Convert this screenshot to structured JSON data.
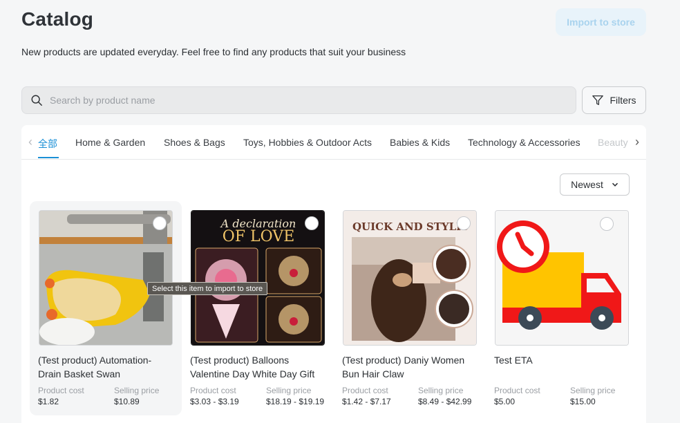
{
  "header": {
    "title": "Catalog",
    "import_label": "Import to store",
    "subtitle": "New products are updated everyday. Feel free to find any products that suit your business"
  },
  "search": {
    "placeholder": "Search by product name",
    "value": ""
  },
  "filters": {
    "label": "Filters"
  },
  "tabs": [
    {
      "label": "全部",
      "active": true
    },
    {
      "label": "Home & Garden"
    },
    {
      "label": "Shoes & Bags"
    },
    {
      "label": "Toys, Hobbies & Outdoor Acts"
    },
    {
      "label": "Babies & Kids"
    },
    {
      "label": "Technology & Accessories"
    },
    {
      "label": "Beauty"
    }
  ],
  "sort": {
    "selected": "Newest"
  },
  "price_labels": {
    "cost": "Product cost",
    "selling": "Selling price"
  },
  "tooltip": "Select this item to import to store",
  "products": [
    {
      "title": "(Test product) Automation-Drain Basket Swan",
      "cost": "$1.82",
      "selling": "$10.89",
      "image": "sink-drain-basket-photo"
    },
    {
      "title": "(Test product) Balloons Valentine Day White Day Gift",
      "cost": "$3.03 - $3.19",
      "selling": "$18.19 - $19.19",
      "image": "valentine-balloons-photo",
      "image_text": [
        "A declaration",
        "OF LOVE"
      ]
    },
    {
      "title": "(Test product) Daniy Women Bun Hair Claw",
      "cost": "$1.42 - $7.17",
      "selling": "$8.49 - $42.99",
      "image": "hair-claw-photo",
      "image_text": [
        "QUICK AND STYLIS"
      ]
    },
    {
      "title": "Test ETA",
      "cost": "$5.00",
      "selling": "$15.00",
      "image": "delivery-truck-clock-icon"
    }
  ],
  "colors": {
    "accent": "#1a8fd6",
    "import_bg": "#e8f3fa",
    "import_text": "#a9d3ee",
    "truck_red": "#f01818",
    "truck_yellow": "#ffc400"
  }
}
